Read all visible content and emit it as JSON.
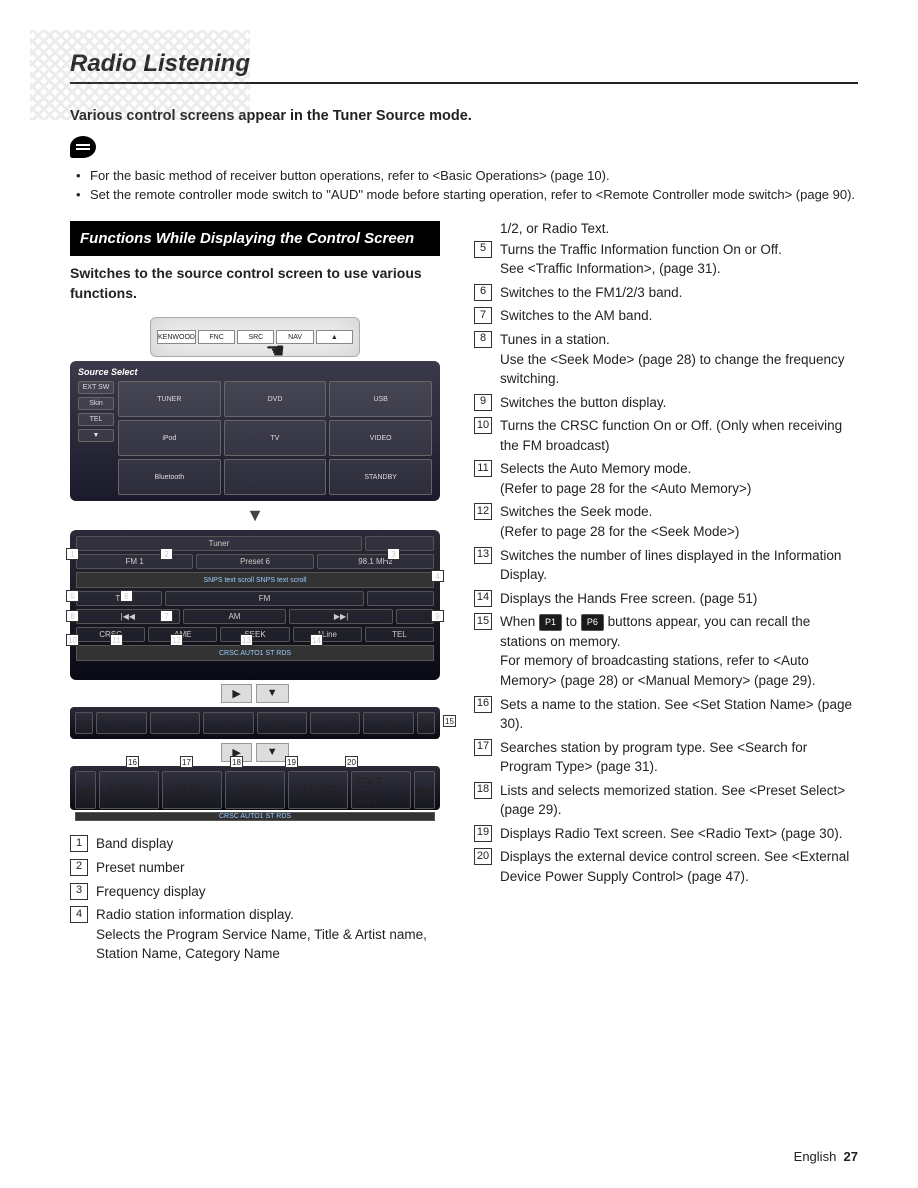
{
  "title": "Radio Listening",
  "intro": "Various control screens appear in the Tuner Source mode.",
  "bullets": [
    "For the basic method of receiver button operations, refer to <Basic Operations> (page 10).",
    "Set the remote controller mode switch to \"AUD\" mode before starting operation, refer to <Remote Controller mode switch> (page 90)."
  ],
  "section": {
    "header": "Functions While Displaying the Control Screen",
    "sub": "Switches to the source control screen to use various functions."
  },
  "head_unit": {
    "brand": "KENWOOD",
    "b2": "FNC",
    "b3": "SRC",
    "b4": "NAV",
    "b5": "▲"
  },
  "source_select": {
    "title": "Source Select",
    "side": [
      "EXT SW",
      "Skin",
      "TEL",
      "▼"
    ],
    "grid": [
      "TUNER",
      "DVD",
      "USB",
      "iPod",
      "TV",
      "VIDEO",
      "Bluetooth",
      "",
      "STANDBY"
    ]
  },
  "tuner": {
    "title": "Tuner",
    "band": "FM 1",
    "preset": "Preset 6",
    "freq": "98.1 MHz",
    "scroll": "SNPS text scroll SNPS text scroll",
    "row_ti": "TI",
    "row_fm": "FM",
    "row_am": "AM",
    "row_crsc": "CRSC",
    "row_ame": "AME",
    "row_seek": "SEEK",
    "row_line": "1Line",
    "row_tel": "TEL",
    "status": "CRSC   AUTO1      ST  RDS"
  },
  "presets": [
    "P1",
    "P2",
    "P3",
    "P4",
    "P5",
    "P6"
  ],
  "namebar": {
    "b1": "NAME",
    "b2": "PTY",
    "b3": "PRE",
    "b4": "TEXT",
    "b5": "EXT SW",
    "status": "CRSC   AUTO1      ST  RDS"
  },
  "callout_tuner": [
    "1",
    "2",
    "3",
    "4",
    "5",
    "6",
    "7",
    "8",
    "9",
    "10",
    "11",
    "12",
    "13",
    "14"
  ],
  "callout_presets": "15",
  "callout_namebar": [
    "16",
    "17",
    "18",
    "19",
    "20"
  ],
  "legend_left": [
    {
      "n": "1",
      "t": "Band display"
    },
    {
      "n": "2",
      "t": "Preset number"
    },
    {
      "n": "3",
      "t": "Frequency display"
    },
    {
      "n": "4",
      "t": "Radio station information display.\nSelects the Program Service Name, Title & Artist name, Station Name, Category Name"
    }
  ],
  "legend_right_pre": "1/2, or Radio Text.",
  "legend_right": [
    {
      "n": "5",
      "t": "Turns the Traffic Information function On or Off.\nSee <Traffic Information>, (page 31)."
    },
    {
      "n": "6",
      "t": "Switches to the FM1/2/3 band."
    },
    {
      "n": "7",
      "t": "Switches to the AM band."
    },
    {
      "n": "8",
      "t": "Tunes in a station.\nUse the <Seek Mode> (page 28) to change the frequency switching."
    },
    {
      "n": "9",
      "t": "Switches the button display."
    },
    {
      "n": "10",
      "t": "Turns the CRSC function On or Off. (Only when receiving the FM broadcast)"
    },
    {
      "n": "11",
      "t": "Selects the Auto Memory mode.\n(Refer to page 28 for the <Auto Memory>)"
    },
    {
      "n": "12",
      "t": "Switches the Seek mode.\n(Refer to page 28 for the <Seek Mode>)"
    },
    {
      "n": "13",
      "t": "Switches the number of lines displayed in the Information Display."
    },
    {
      "n": "14",
      "t": "Displays the Hands Free screen. (page 51)"
    },
    {
      "n": "15",
      "_p1": "P1",
      "_to": " to ",
      "_p6": "P6",
      "t_pre": "When ",
      "t": " buttons appear, you can recall the stations on memory.\nFor memory of broadcasting stations, refer to <Auto Memory> (page 28) or <Manual Memory> (page 29)."
    },
    {
      "n": "16",
      "t": "Sets a name to the station. See <Set Station Name> (page 30)."
    },
    {
      "n": "17",
      "t": "Searches station by program type. See <Search for Program Type> (page 31)."
    },
    {
      "n": "18",
      "t": "Lists and selects memorized station. See <Preset Select> (page 29)."
    },
    {
      "n": "19",
      "t": "Displays Radio Text screen. See <Radio Text> (page 30)."
    },
    {
      "n": "20",
      "t": "Displays the external device control screen. See <External Device Power Supply Control> (page 47)."
    }
  ],
  "footer": {
    "lang": "English",
    "page": "27"
  }
}
